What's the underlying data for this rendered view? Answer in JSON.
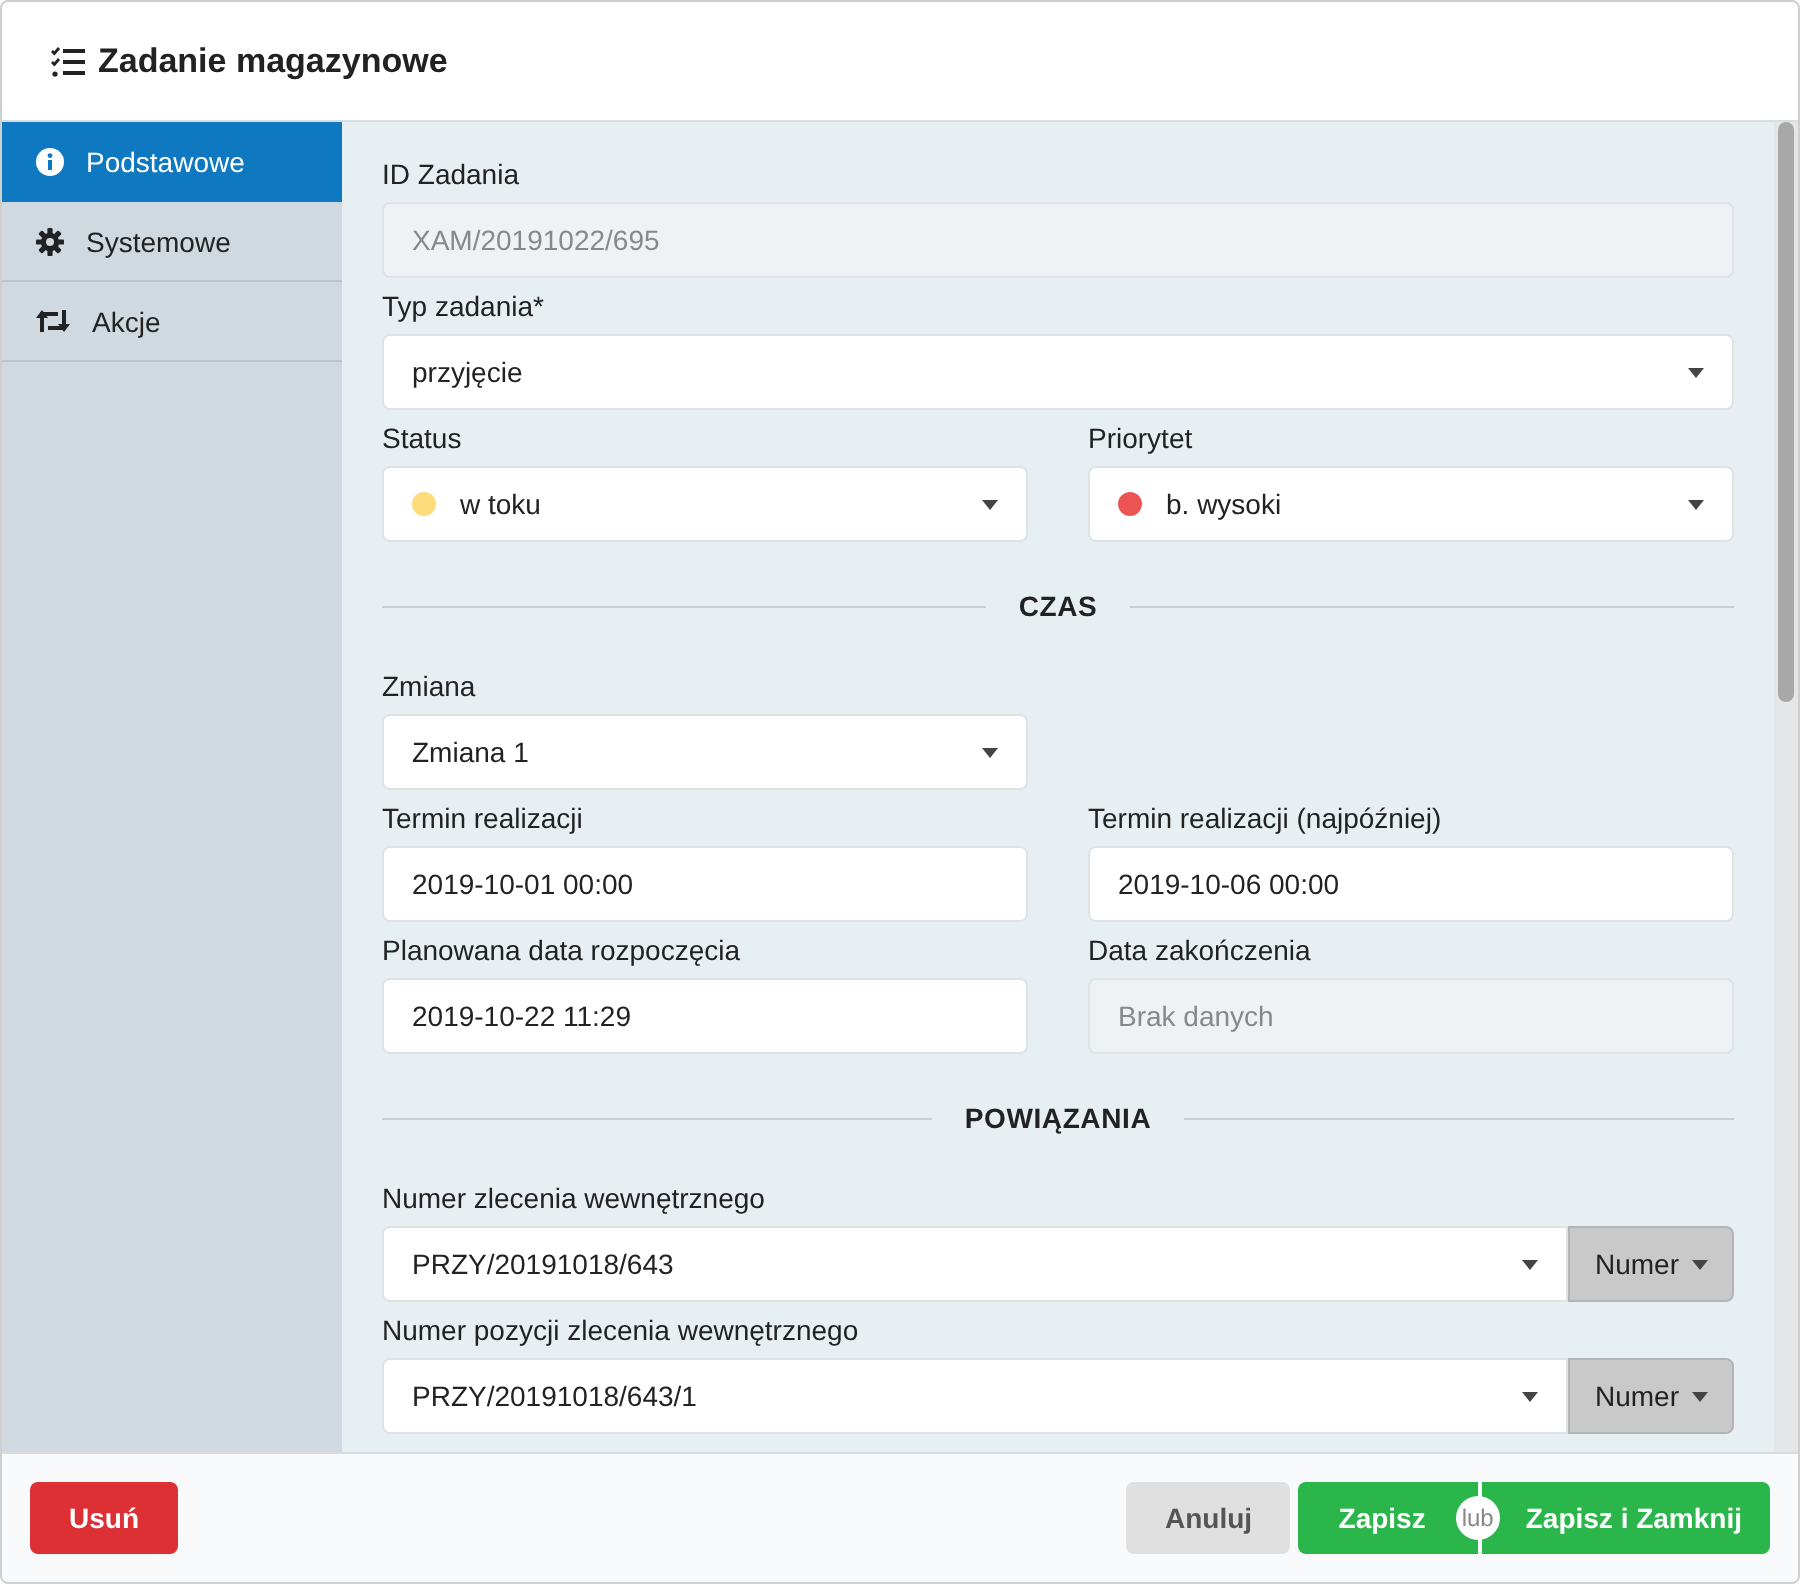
{
  "window": {
    "title": "Zadanie magazynowe"
  },
  "sidebar": {
    "items": [
      {
        "label": "Podstawowe",
        "selected": true
      },
      {
        "label": "Systemowe",
        "selected": false
      },
      {
        "label": "Akcje",
        "selected": false
      }
    ]
  },
  "form": {
    "rows": [
      {
        "kind": "wide",
        "fields": [
          {
            "label": "ID Zadania",
            "kind": "readonly",
            "value": "XAM/20191022/695"
          }
        ]
      },
      {
        "kind": "wide",
        "fields": [
          {
            "label": "Typ zadania*",
            "kind": "select",
            "value": "przyjęcie"
          }
        ]
      },
      {
        "kind": "pair",
        "fields": [
          {
            "label": "Status",
            "kind": "select",
            "value": "w toku",
            "color": "#fddc7c"
          },
          {
            "label": "Priorytet",
            "kind": "select",
            "value": "b. wysoki",
            "color": "#ec5454"
          }
        ]
      },
      {
        "kind": "heading",
        "text": "CZAS"
      },
      {
        "kind": "pair",
        "fields": [
          {
            "label": "Zmiana",
            "kind": "select",
            "value": "Zmiana 1"
          }
        ]
      },
      {
        "kind": "pair",
        "fields": [
          {
            "label": "Termin realizacji",
            "kind": "input",
            "value": "2019-10-01 00:00"
          },
          {
            "label": "Termin realizacji (najpóźniej)",
            "kind": "input",
            "value": "2019-10-06 00:00"
          }
        ]
      },
      {
        "kind": "pair",
        "fields": [
          {
            "label": "Planowana data rozpoczęcia",
            "kind": "input",
            "value": "2019-10-22 11:29"
          },
          {
            "label": "Data zakończenia",
            "kind": "readonly",
            "placeholder": "Brak danych"
          }
        ]
      },
      {
        "kind": "heading",
        "text": "POWIĄZANIA"
      },
      {
        "kind": "wide",
        "fields": [
          {
            "label": "Numer zlecenia wewnętrznego",
            "kind": "select",
            "value": "PRZY/20191018/643",
            "addon": "Numer"
          }
        ]
      },
      {
        "kind": "wide",
        "fields": [
          {
            "label": "Numer pozycji zlecenia wewnętrznego",
            "kind": "select",
            "value": "PRZY/20191018/643/1",
            "addon": "Numer"
          }
        ]
      }
    ]
  },
  "footer": {
    "left": [
      {
        "label": "Usuń",
        "kind": "danger"
      }
    ],
    "right": [
      {
        "label": "Anuluj",
        "kind": "secondary"
      },
      {
        "label": "Zapisz",
        "kind": "primary"
      },
      {
        "label": "lub",
        "kind": "separator"
      },
      {
        "label": "Zapisz i Zamknij",
        "kind": "primary"
      }
    ]
  }
}
